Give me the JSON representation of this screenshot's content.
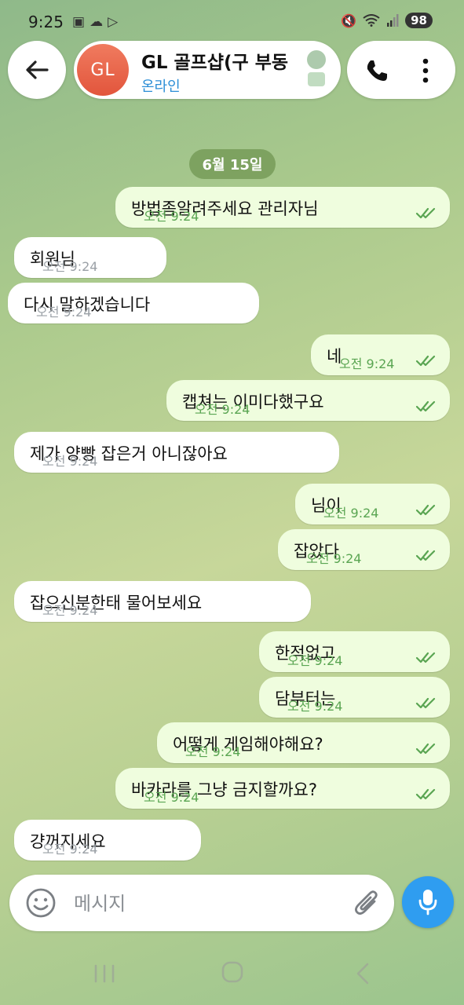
{
  "status_bar": {
    "time": "9:25",
    "battery": "98",
    "left_icons": [
      "screenshot-icon",
      "cloud-icon",
      "play-icon"
    ],
    "right_icons": [
      "mute-icon",
      "wifi-icon",
      "signal-icon"
    ]
  },
  "header": {
    "avatar_initials": "GL",
    "title": "GL 골프샵(구 부동",
    "status": "온라인",
    "accent": "#2c8ed6"
  },
  "chat": {
    "date_label": "6월 15일",
    "messages": [
      {
        "dir": "out",
        "text": "방법좀알려주세요 관리자님",
        "time": "오전 9:24",
        "read": true
      },
      {
        "dir": "in",
        "text": "회원님",
        "time": "오전 9:24"
      },
      {
        "dir": "in",
        "text": "다시 말하겠습니다",
        "time": "오전 9:24"
      },
      {
        "dir": "out",
        "text": "네",
        "time": "오전 9:24",
        "read": true
      },
      {
        "dir": "out",
        "text": "캡쳐는 이미다했구요",
        "time": "오전 9:24",
        "read": true
      },
      {
        "dir": "in",
        "text": "제가 양빵 잡은거 아니잖아요",
        "time": "오전 9:24"
      },
      {
        "dir": "out",
        "text": "님이",
        "time": "오전 9:24",
        "read": true
      },
      {
        "dir": "out",
        "text": "잡았다",
        "time": "오전 9:24",
        "read": true
      },
      {
        "dir": "in",
        "text": "잡으신분한태 물어보세요",
        "time": "오전 9:24"
      },
      {
        "dir": "out",
        "text": "한적없고",
        "time": "오전 9:24",
        "read": true
      },
      {
        "dir": "out",
        "text": "담부터는",
        "time": "오전 9:24",
        "read": true
      },
      {
        "dir": "out",
        "text": "어떻게 게임해야해요?",
        "time": "오전 9:24",
        "read": true
      },
      {
        "dir": "out",
        "text": "바카라를 그냥 금지할까요?",
        "time": "오전 9:24",
        "read": true
      },
      {
        "dir": "in",
        "text": "걍꺼지세요",
        "time": "오전 9:24"
      }
    ],
    "colors": {
      "incoming": "#ffffff",
      "outgoing": "#effdde",
      "out_time": "#5aa552"
    }
  },
  "composer": {
    "placeholder": "메시지",
    "mic_color": "#2f9df0"
  }
}
